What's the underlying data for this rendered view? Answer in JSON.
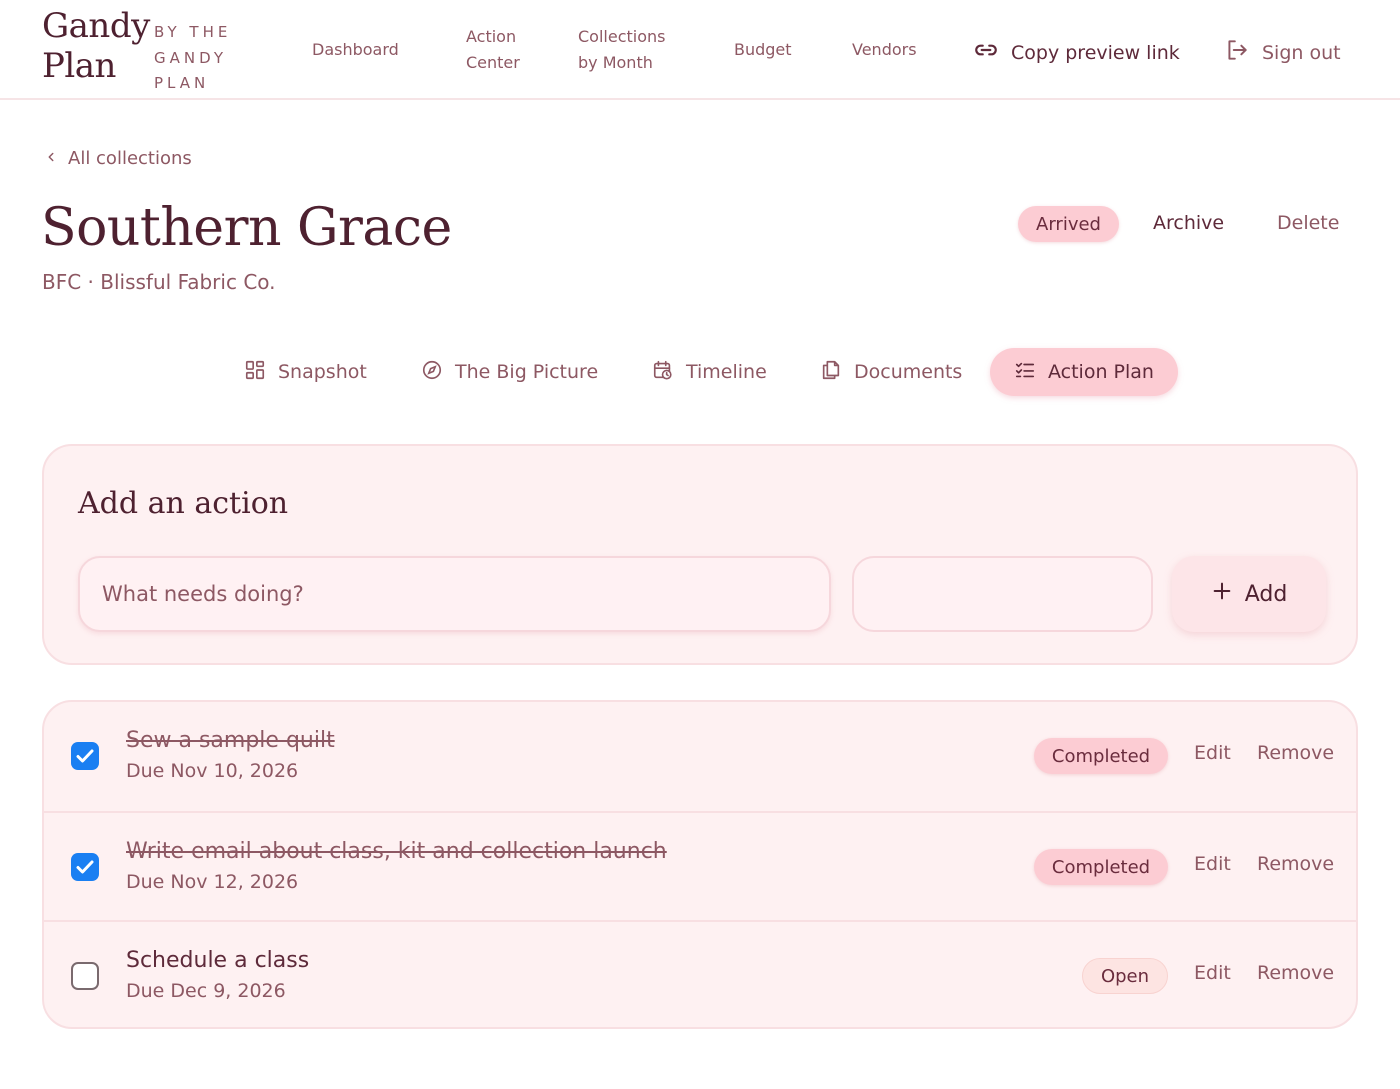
{
  "brand": {
    "name_line1": "Gandy",
    "name_line2": "Plan",
    "tag_line1": "BY THE",
    "tag_line2": "GANDY",
    "tag_line3": "PLAN"
  },
  "nav": {
    "dashboard": "Dashboard",
    "action_center_1": "Action",
    "action_center_2": "Center",
    "collections_1": "Collections",
    "collections_2": "by Month",
    "budget": "Budget",
    "vendors": "Vendors",
    "copy_link": "Copy preview link",
    "sign_out": "Sign out"
  },
  "breadcrumb": "All collections",
  "collection": {
    "title": "Southern Grace",
    "subtitle": "BFC · Blissful Fabric Co.",
    "status": "Arrived",
    "archive": "Archive",
    "delete": "Delete"
  },
  "tabs": [
    {
      "label": "Snapshot",
      "icon": "grid-icon"
    },
    {
      "label": "The Big Picture",
      "icon": "compass-icon"
    },
    {
      "label": "Timeline",
      "icon": "calendar-clock-icon"
    },
    {
      "label": "Documents",
      "icon": "documents-icon"
    },
    {
      "label": "Action Plan",
      "icon": "checklist-icon",
      "active": true
    }
  ],
  "add_action": {
    "title": "Add an action",
    "placeholder": "What needs doing?",
    "date_value": "",
    "button": "Add"
  },
  "actions": [
    {
      "title": "Sew a sample quilt",
      "due": "Due Nov 10, 2026",
      "status": "Completed",
      "checked": true
    },
    {
      "title": "Write email about class, kit and collection launch",
      "due": "Due Nov 12, 2026",
      "status": "Completed",
      "checked": true
    },
    {
      "title": "Schedule a class",
      "due": "Due Dec 9, 2026",
      "status": "Open",
      "checked": false
    }
  ],
  "row_actions": {
    "edit": "Edit",
    "remove": "Remove"
  },
  "colors": {
    "accent_pink": "#fcccd3",
    "card_bg": "#fef1f2",
    "checkbox_blue": "#1a7ff2",
    "title_text": "#4e2130"
  }
}
